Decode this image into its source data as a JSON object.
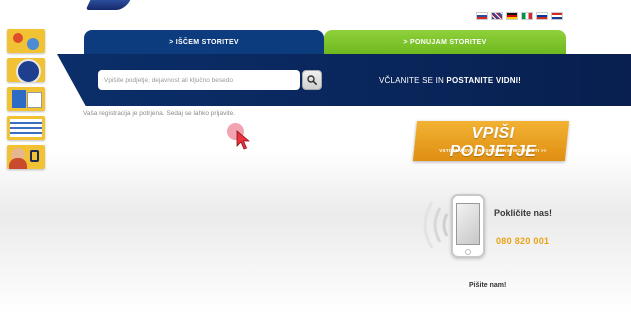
{
  "header": {
    "languages": [
      "Slovenščina",
      "English",
      "Deutsch",
      "Italiano",
      "Русский",
      "Hrvatski"
    ]
  },
  "sidebar": {
    "icons": [
      "services-icon",
      "globe-badge-icon",
      "documents-icon",
      "catalog-icon",
      "support-agent-icon"
    ]
  },
  "tabs": {
    "search_services": "> IŠČEM STORITEV",
    "offer_services": "> PONUJAM STORITEV"
  },
  "search": {
    "placeholder": "Vpišite podjetje, dejavnost ali ključno besedo",
    "button_icon": "magnifier-icon"
  },
  "join": {
    "prefix": "VČLANITE SE IN ",
    "emphasis": "POSTANITE VIDNI!"
  },
  "notice": "Vaša registracija je potrjena. Sedaj se lahko prijavite.",
  "banner": {
    "title": "VPIŠI PODJETJE",
    "subtitle": "VSTOPI V SVET NESKONČNIH MOŽNOSTI >>"
  },
  "contact": {
    "call_title": "Pokličite nas!",
    "phone_number": "080 820 001",
    "write_title": "Pišite nam!"
  },
  "colors": {
    "primary_tab": "#0c3b7e",
    "secondary_tab": "#7cc22a",
    "banner": "#e9a020",
    "phone_number": "#e7a317"
  }
}
